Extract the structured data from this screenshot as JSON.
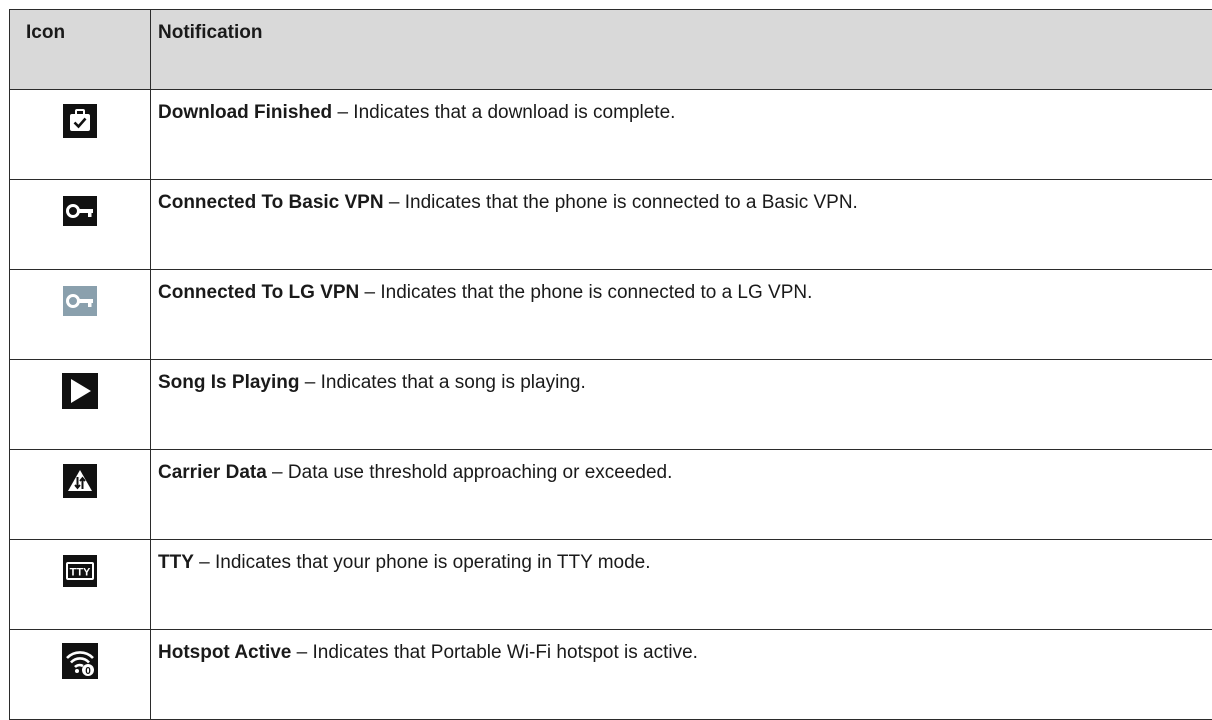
{
  "table": {
    "headers": {
      "icon": "Icon",
      "notification": "Notification"
    },
    "rows": [
      {
        "icon": "download-finished-icon",
        "title": "Download Finished",
        "separator": " – ",
        "description": "Indicates that a download is complete."
      },
      {
        "icon": "vpn-key-icon",
        "title": "Connected To Basic VPN",
        "separator": " – ",
        "description": "Indicates that the phone is connected to a Basic VPN."
      },
      {
        "icon": "vpn-key-lg-icon",
        "title": "Connected To LG VPN",
        "separator": " – ",
        "description": "Indicates that the phone is connected to a LG VPN."
      },
      {
        "icon": "play-icon",
        "title": "Song Is Playing",
        "separator": " – ",
        "description": "Indicates that a song is playing."
      },
      {
        "icon": "data-warning-icon",
        "title": "Carrier Data",
        "separator": " – ",
        "description": "Data use threshold approaching or exceeded."
      },
      {
        "icon": "tty-icon",
        "title": "TTY",
        "separator": " – ",
        "description": "Indicates that your phone is operating in TTY mode.",
        "icon_text": "TTY"
      },
      {
        "icon": "hotspot-icon",
        "title": "Hotspot Active",
        "separator": " – ",
        "description": "Indicates that Portable Wi-Fi hotspot is active.",
        "icon_text": "0"
      }
    ]
  },
  "colors": {
    "header_bg": "#d9d9d9",
    "border": "#2b2b2b",
    "icon_dark": "#111111",
    "icon_grey": "#8aa0ad"
  }
}
